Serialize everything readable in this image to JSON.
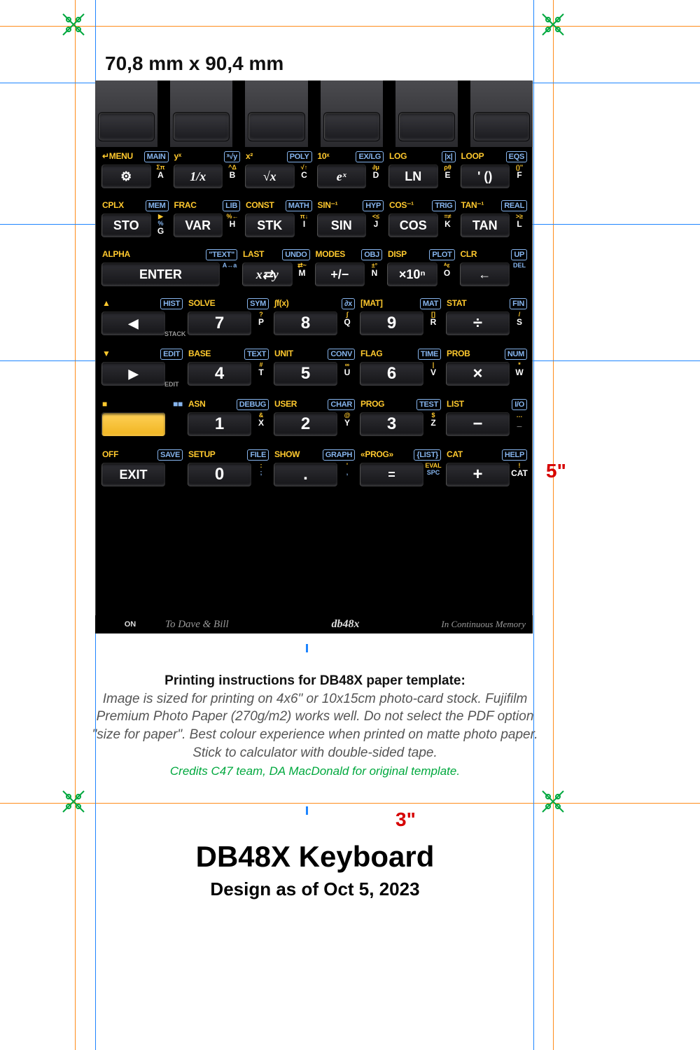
{
  "dimensions": {
    "mm": "70,8 mm x 90,4 mm",
    "h": "5\"",
    "w": "3\""
  },
  "rows": [
    [
      {
        "tl": "↵MENU",
        "tr": "MAIN",
        "key": "⚙",
        "y": "Σπ",
        "b": "",
        "ltr": "A"
      },
      {
        "tl": "yˣ",
        "tr": "ˣ√y",
        "key": "1/x",
        "y": "^Δ",
        "b": "",
        "ltr": "B",
        "ital": true
      },
      {
        "tl": "x²",
        "tr": "POLY",
        "key": "√x",
        "y": "√↑",
        "b": "",
        "ltr": "C",
        "ital": true
      },
      {
        "tl": "10ˣ",
        "tr": "EX/LG",
        "key": "eˣ",
        "y": "∂μ",
        "b": "",
        "ltr": "D",
        "ital": true
      },
      {
        "tl": "LOG",
        "tr": "|x|",
        "key": "LN",
        "y": "ρθ",
        "b": "",
        "ltr": "E"
      },
      {
        "tl": "LOOP",
        "tr": "EQS",
        "key": "' ()",
        "y": "()''",
        "b": "",
        "ltr": "F"
      }
    ],
    [
      {
        "tl": "CPLX",
        "tr": "MEM",
        "key": "STO",
        "y": "▶",
        "b": "%",
        "ltr": "G"
      },
      {
        "tl": "FRAC",
        "tr": "LIB",
        "key": "VAR",
        "y": "%←",
        "b": "",
        "ltr": "H"
      },
      {
        "tl": "CONST",
        "tr": "MATH",
        "key": "STK",
        "y": "π↓",
        "b": "",
        "ltr": "I"
      },
      {
        "tl": "SIN⁻¹",
        "tr": "HYP",
        "key": "SIN",
        "y": "<≤",
        "b": "",
        "ltr": "J"
      },
      {
        "tl": "COS⁻¹",
        "tr": "TRIG",
        "key": "COS",
        "y": "=≠",
        "b": "",
        "ltr": "K"
      },
      {
        "tl": "TAN⁻¹",
        "tr": "REAL",
        "key": "TAN",
        "y": ">≥",
        "b": "",
        "ltr": "L"
      }
    ],
    [
      {
        "tl": "ALPHA",
        "tr": "\"TEXT\"",
        "key": "ENTER",
        "wide": true,
        "y": "",
        "b": "A↔a",
        "ltr": ""
      },
      {
        "tl": "LAST",
        "tr": "UNDO",
        "key": "x⇄y",
        "y": "⇄~",
        "b": "",
        "ltr": "M",
        "ital": true
      },
      {
        "tl": "MODES",
        "tr": "OBJ",
        "key": "+/−",
        "y": "±°",
        "b": "",
        "ltr": "N"
      },
      {
        "tl": "DISP",
        "tr": "PLOT",
        "key": "×10ⁿ",
        "y": "ᴬε",
        "b": "",
        "ltr": "O"
      },
      {
        "tl": "CLR",
        "tr": "UP",
        "key": "←",
        "y": "",
        "b": "DEL",
        "ltr": ""
      }
    ],
    [
      {
        "tl": "▲",
        "tr": "HIST",
        "key": "◀",
        "sm": "STACK",
        "tlcolor": "y"
      },
      {
        "tl": "SOLVE",
        "tr": "SYM",
        "key": "7",
        "y": "?",
        "b": "",
        "ltr": "P",
        "big": true
      },
      {
        "tl": "∫f(x)",
        "tr": "∂x",
        "key": "8",
        "y": "∫",
        "b": "",
        "ltr": "Q",
        "big": true
      },
      {
        "tl": "[MAT]",
        "tr": "MAT",
        "key": "9",
        "y": "[]",
        "b": "",
        "ltr": "R",
        "big": true
      },
      {
        "tl": "STAT",
        "tr": "FIN",
        "key": "÷",
        "y": "/",
        "b": "",
        "ltr": "S",
        "big": true
      }
    ],
    [
      {
        "tl": "▼",
        "tr": "EDIT",
        "key": "▶",
        "sm": "EDIT",
        "tlcolor": "y"
      },
      {
        "tl": "BASE",
        "tr": "TEXT",
        "key": "4",
        "y": "#",
        "b": "",
        "ltr": "T",
        "big": true
      },
      {
        "tl": "UNIT",
        "tr": "CONV",
        "key": "5",
        "y": "∞",
        "b": "",
        "ltr": "U",
        "big": true
      },
      {
        "tl": "FLAG",
        "tr": "TIME",
        "key": "6",
        "y": "|",
        "b": "",
        "ltr": "V",
        "big": true
      },
      {
        "tl": "PROB",
        "tr": "NUM",
        "key": "×",
        "y": "*",
        "b": "",
        "ltr": "W",
        "big": true
      }
    ],
    [
      {
        "tl": "■",
        "tr": "■■",
        "key": "",
        "yel": true
      },
      {
        "tl": "ASN",
        "tr": "DEBUG",
        "key": "1",
        "y": "&",
        "b": "",
        "ltr": "X",
        "big": true
      },
      {
        "tl": "USER",
        "tr": "CHAR",
        "key": "2",
        "y": "@",
        "b": "",
        "ltr": "Y",
        "big": true
      },
      {
        "tl": "PROG",
        "tr": "TEST",
        "key": "3",
        "y": "$",
        "b": "",
        "ltr": "Z",
        "big": true
      },
      {
        "tl": "LIST",
        "tr": "I/O",
        "key": "−",
        "y": "…",
        "b": "",
        "ltr": "_",
        "big": true
      }
    ],
    [
      {
        "tl": "OFF",
        "tr": "SAVE",
        "key": "EXIT"
      },
      {
        "tl": "SETUP",
        "tr": "FILE",
        "key": "0",
        "y": ":",
        "b": ";",
        "ltr": "",
        "big": true
      },
      {
        "tl": "SHOW",
        "tr": "GRAPH",
        "key": ".",
        "y": "'",
        "b": ",",
        "ltr": "",
        "big": true
      },
      {
        "tl": "«PROG»",
        "tr": "{LIST}",
        "key": "=",
        "y": "EVAL",
        "b": "SPC",
        "ltr": "",
        "side2": "SPC { }"
      },
      {
        "tl": "CAT",
        "tr": "HELP",
        "key": "+",
        "y": "!",
        "b": "",
        "ltr": "CAT",
        "big": true
      }
    ]
  ],
  "footer": {
    "on": "ON",
    "dedication": "To Dave & Bill",
    "logo": "db48x",
    "memory": "In Continuous Memory"
  },
  "instructions": {
    "heading": "Printing instructions for DB48X paper template:",
    "body": "Image is sized for printing on 4x6\" or 10x15cm photo-card stock. Fujifilm Premium Photo Paper (270g/m2) works well. Do not select the PDF option \"size for paper\". Best colour experience when printed on matte photo paper. Stick to calculator with double-sided tape.",
    "credit": "Credits C47 team, DA MacDonald for original template."
  },
  "title": "DB48X Keyboard",
  "subtitle": "Design as of Oct 5, 2023"
}
